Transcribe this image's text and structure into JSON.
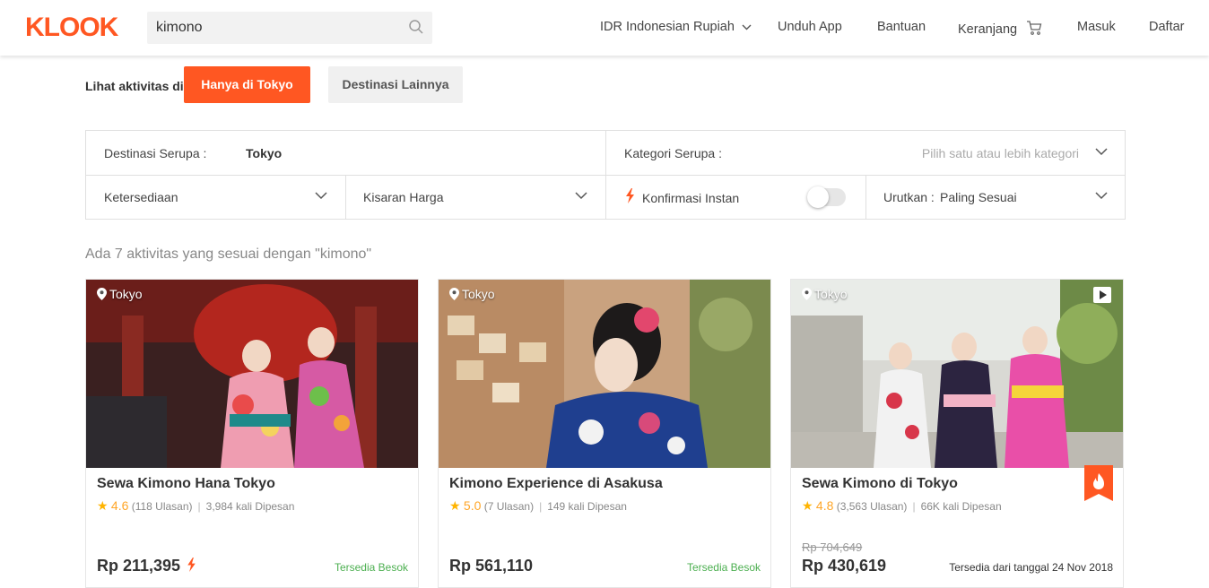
{
  "header": {
    "logo": "KLOOK",
    "search_value": "kimono",
    "currency": "IDR  Indonesian Rupiah",
    "download_app": "Unduh App",
    "help": "Bantuan",
    "cart": "Keranjang",
    "login": "Masuk",
    "register": "Daftar",
    "brand_color": "#ff5722"
  },
  "location_filter": {
    "label": "Lihat aktivitas di:",
    "only_tokyo": "Hanya di Tokyo",
    "other_destinations": "Destinasi Lainnya"
  },
  "filters": {
    "similar_destinations_label": "Destinasi Serupa :",
    "similar_destinations_value": "Tokyo",
    "similar_categories_label": "Kategori Serupa :",
    "similar_categories_placeholder": "Pilih satu atau lebih kategori",
    "availability": "Ketersediaan",
    "price_range": "Kisaran Harga",
    "instant_confirmation": "Konfirmasi Instan",
    "instant_confirmation_on": false,
    "sort_label": "Urutkan :",
    "sort_value": "Paling Sesuai"
  },
  "result_count": "Ada 7 aktivitas yang sesuai dengan \"kimono\"",
  "cards": [
    {
      "location": "Tokyo",
      "title": "Sewa Kimono Hana Tokyo",
      "rating": "4.6",
      "reviews": "(118 Ulasan)",
      "booked": "3,984 kali Dipesan",
      "price": "Rp 211,395",
      "old_price": "",
      "availability": "Tersedia Besok",
      "instant": true
    },
    {
      "location": "Tokyo",
      "title": "Kimono Experience di Asakusa",
      "rating": "5.0",
      "reviews": "(7 Ulasan)",
      "booked": "149 kali Dipesan",
      "price": "Rp 561,110",
      "old_price": "",
      "availability": "Tersedia Besok",
      "instant": false
    },
    {
      "location": "Tokyo",
      "title": "Sewa Kimono di Tokyo",
      "rating": "4.8",
      "reviews": "(3,563 Ulasan)",
      "booked": "66K kali Dipesan",
      "price": "Rp 430,619",
      "old_price": "Rp 704,649",
      "availability": "Tersedia dari tanggal 24 Nov 2018",
      "instant": false
    }
  ]
}
